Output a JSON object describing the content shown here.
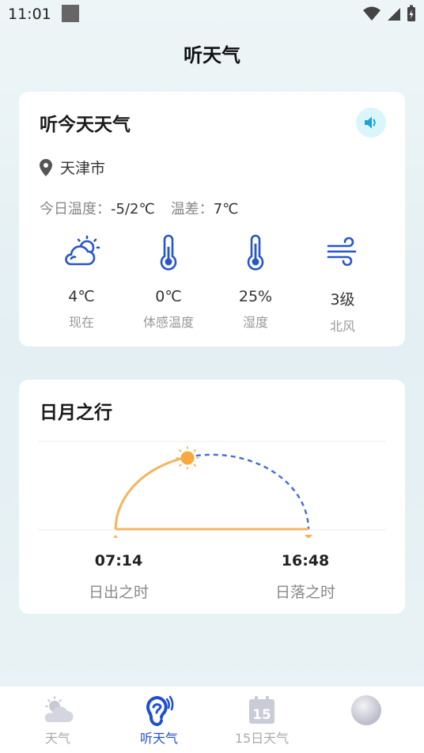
{
  "status_bar": {
    "time": "11:01"
  },
  "header": {
    "title": "听天气"
  },
  "weather_card": {
    "title": "听今天天气",
    "speaker_icon": "speaker-icon",
    "location": "天津市",
    "temp_label": "今日温度：",
    "temp_value": "-5/2℃",
    "diff_label": "温差：",
    "diff_value": "7℃",
    "stats": [
      {
        "icon": "cloudy-sun-icon",
        "value": "4℃",
        "label": "现在"
      },
      {
        "icon": "thermometer-icon",
        "value": "0℃",
        "label": "体感温度"
      },
      {
        "icon": "thermometer-icon",
        "value": "25%",
        "label": "湿度"
      },
      {
        "icon": "wind-icon",
        "value": "3级",
        "label": "北风"
      }
    ]
  },
  "sun_card": {
    "title": "日月之行",
    "sunrise_time": "07:14",
    "sunrise_label": "日出之时",
    "sunset_time": "16:48",
    "sunset_label": "日落之时",
    "colors": {
      "day_arc": "#f5b461",
      "night_arc": "#4a6fd6",
      "sun": "#f7a93c"
    }
  },
  "nav": {
    "items": [
      {
        "label": "天气",
        "icon": "weather-icon",
        "active": false
      },
      {
        "label": "听天气",
        "icon": "ear-icon",
        "active": true
      },
      {
        "label": "15日天气",
        "icon": "calendar-15-icon",
        "active": false
      },
      {
        "label": "",
        "icon": "avatar-icon",
        "active": false
      }
    ],
    "active_color": "#1f4fd1"
  }
}
